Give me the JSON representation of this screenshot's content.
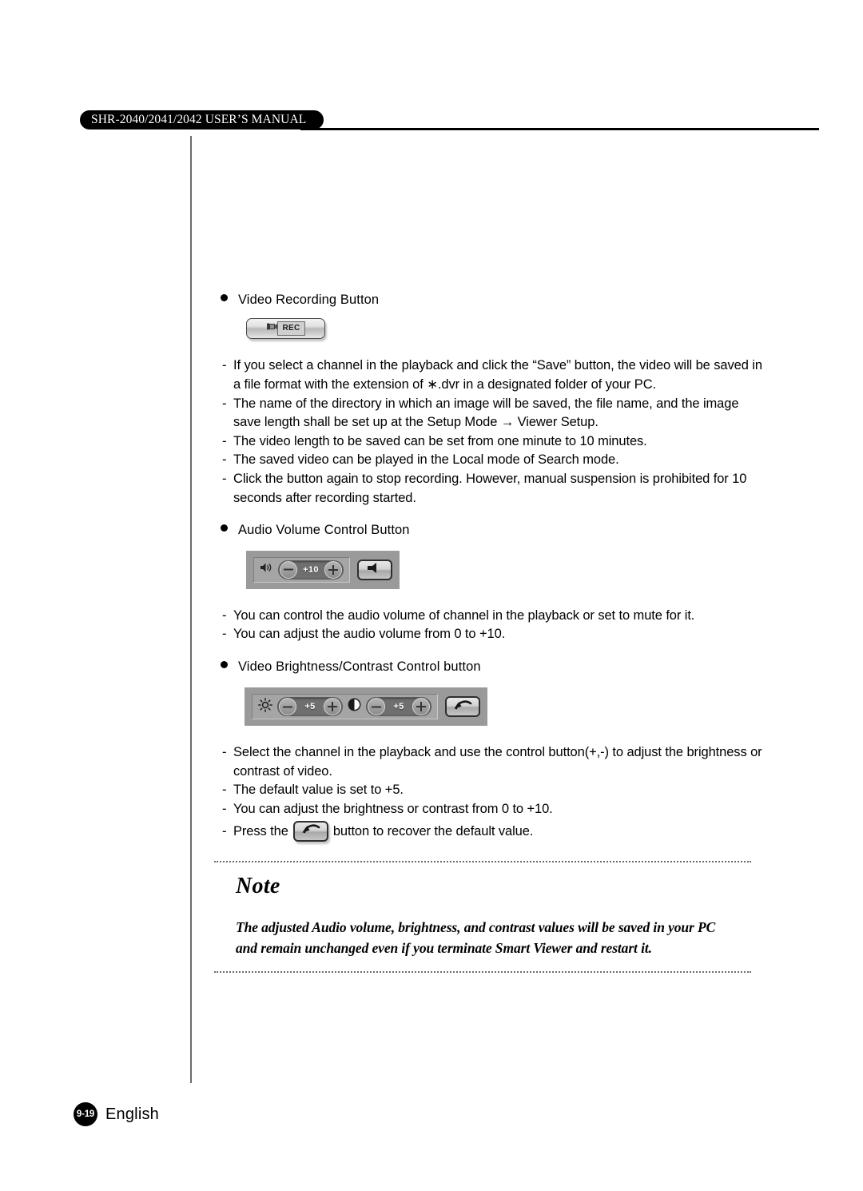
{
  "header": {
    "manual_title": "SHR-2040/2041/2042 USER’S MANUAL"
  },
  "sections": [
    {
      "bullet_label": "Video Recording Button",
      "widget": "rec-button",
      "items": [
        "If you select a channel in the playback and click the “Save” button, the video will be saved in a file format with the extension of ∗.dvr in a designated folder of your PC.",
        "The name of the directory in which an image will be saved, the file name, and the image save length shall be set up at the Setup Mode → Viewer Setup.",
        "The video length to be saved can be set from one minute to 10 minutes.",
        "The saved video can be played in the Local mode of Search mode.",
        "Click the button again to stop recording. However, manual suspension is prohibited for 10 seconds after recording started."
      ]
    },
    {
      "bullet_label": "Audio Volume Control Button",
      "widget": "audio-volume-bar",
      "items": [
        "You can control the audio volume of channel in the playback or set to mute for it.",
        "You can adjust the audio volume from 0 to +10."
      ]
    },
    {
      "bullet_label": "Video Brightness/Contrast Control button",
      "widget": "brightness-contrast-bar",
      "items": [
        "Select the channel in the playback and use the control button(+,-) to adjust the brightness or contrast of video.",
        "The default value is set to +5.",
        "You can adjust the brightness or contrast from 0 to +10."
      ],
      "inline_item": {
        "prefix": "Press the",
        "suffix": "button to recover the default value."
      }
    }
  ],
  "widgets": {
    "rec_button": {
      "label": "REC",
      "camera_icon": "video-camera-icon"
    },
    "audio_bar": {
      "speaker_icon": "speaker-icon",
      "minus_icon": "minus-circle-icon",
      "plus_icon": "plus-circle-icon",
      "value": "+10",
      "mute_icon": "speaker-mute-icon"
    },
    "brightness_contrast_bar": {
      "brightness_icon": "sun-icon",
      "brightness_value": "+5",
      "contrast_icon": "contrast-half-circle-icon",
      "contrast_value": "+5",
      "minus_icon": "minus-circle-icon",
      "plus_icon": "plus-circle-icon",
      "reset_icon": "undo-arrow-icon"
    }
  },
  "note": {
    "title": "Note",
    "line1": "The adjusted Audio volume, brightness, and contrast values will be saved in your PC",
    "line2": "and remain unchanged even if you terminate Smart Viewer and restart it."
  },
  "footer": {
    "page_number": "9-19",
    "language": "English"
  },
  "colors": {
    "header_pill_bg": "#000000",
    "panel_gray": "#9a9a9a",
    "stepper_dark": "#6f6f6f",
    "rule_gray": "#6d6d6d"
  }
}
